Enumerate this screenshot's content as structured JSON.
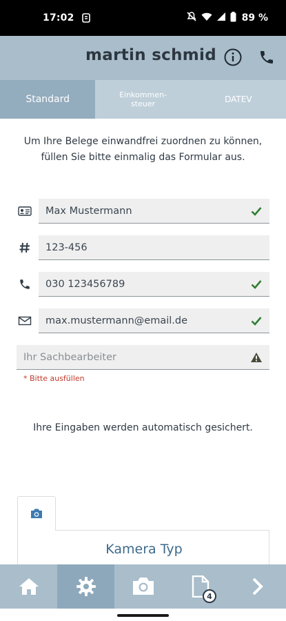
{
  "status_bar": {
    "time": "17:02",
    "battery": "89 %"
  },
  "header": {
    "title": "martin schmid"
  },
  "tabs": [
    {
      "label": "Standard",
      "active": true
    },
    {
      "label": "Einkommen-\nsteuer",
      "active": false
    },
    {
      "label": "DATEV",
      "active": false
    }
  ],
  "intro": {
    "line1": "Um Ihre Belege einwandfrei zuordnen zu können,",
    "line2": "füllen Sie bitte einmalig das Formular aus."
  },
  "form": {
    "name": {
      "value": "Max Mustermann",
      "status": "valid"
    },
    "client_number": {
      "value": "123-456",
      "status": "none"
    },
    "phone": {
      "value": "030 123456789",
      "status": "valid"
    },
    "email": {
      "value": "max.mustermann@email.de",
      "status": "valid"
    },
    "clerk": {
      "value": "",
      "placeholder": "Ihr Sachbearbeiter",
      "status": "warning"
    },
    "clerk_hint": "* Bitte ausfüllen"
  },
  "autosave_note": "Ihre Eingaben werden automatisch gesichert.",
  "camera": {
    "type_label": "Kamera Typ"
  },
  "bottom_nav": {
    "items": [
      "home-icon",
      "gear-icon",
      "camera-icon",
      "document-icon",
      "chevron-right-icon"
    ],
    "active_index": 1,
    "document_badge": "4"
  },
  "colors": {
    "header_bg": "#a9bdcb",
    "tab_active_bg": "#93acbe",
    "valid": "#2e7d32",
    "warning": "#4a4a3a",
    "hint": "#c0392b",
    "accent_blue": "#3d6a8c"
  }
}
